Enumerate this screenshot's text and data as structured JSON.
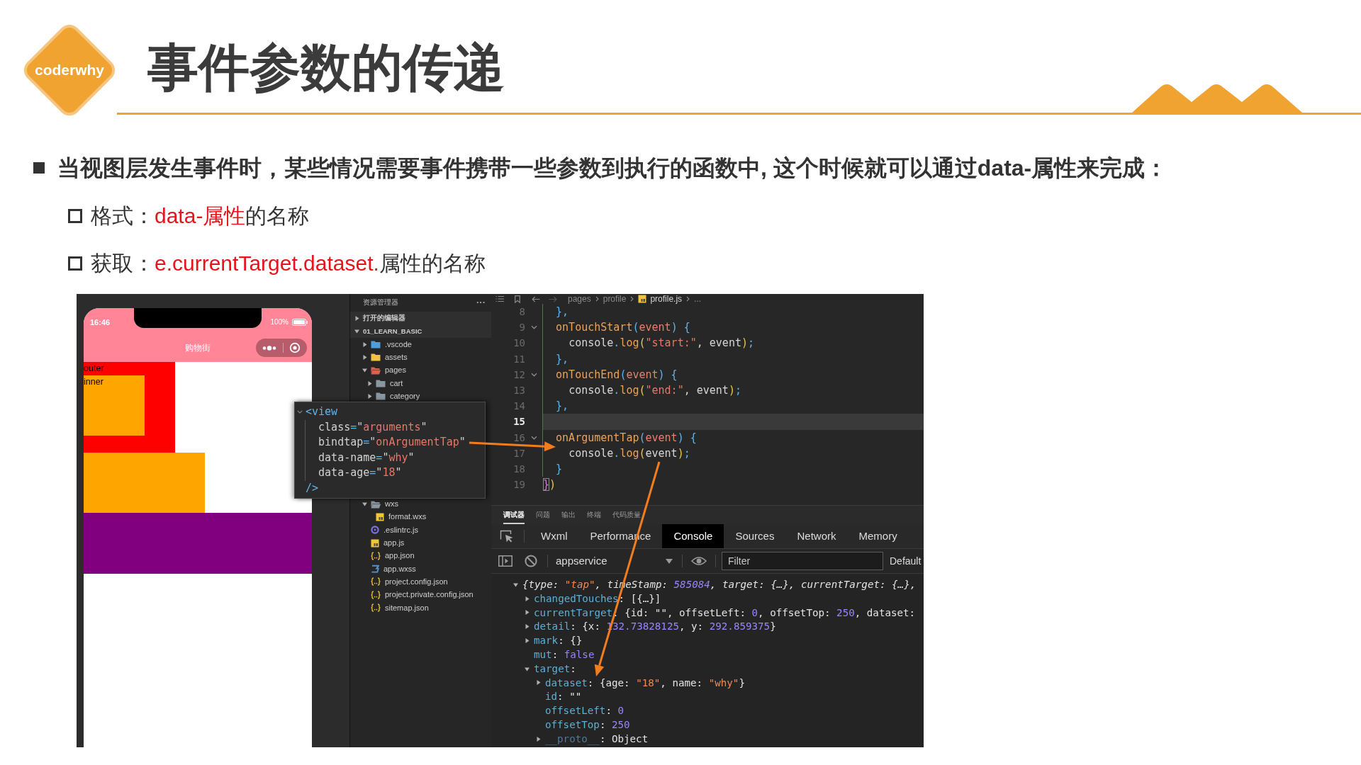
{
  "header": {
    "logo": "coderwhy",
    "title": "事件参数的传递"
  },
  "bullets": [
    {
      "text": "当视图层发生事件时，某些情况需要事件携带一些参数到执行的函数中, 这个时候就可以通过data-属性来完成：",
      "children": [
        {
          "label": "格式：",
          "highlight": "data-属性",
          "rest": "的名称"
        },
        {
          "label": "获取：",
          "highlight": "e.currentTarget.dataset.",
          "rest": "属性的名称"
        }
      ]
    }
  ],
  "screenshot": {
    "simulator": {
      "time": "16:46",
      "battery": "100%",
      "title": "购物街",
      "views": [
        {
          "label": "outer",
          "color": "#ff0000",
          "children": [
            {
              "label": "inner",
              "color": "#ffa500"
            }
          ]
        },
        {
          "color": "#ffa500"
        },
        {
          "color": "#800080"
        }
      ]
    },
    "explorer": {
      "title": "资源管理器",
      "more": "···",
      "sections": [
        {
          "label": "打开的编辑器",
          "expanded": false
        },
        {
          "label": "01_LEARN_BASIC",
          "expanded": true,
          "children": [
            {
              "name": ".vscode",
              "kind": "folder",
              "color": "#4a9fe3",
              "expanded": false
            },
            {
              "name": "assets",
              "kind": "folder",
              "color": "#f2c342",
              "expanded": false
            },
            {
              "name": "pages",
              "kind": "folder",
              "color": "#e0604e",
              "expanded": true,
              "children": [
                {
                  "name": "cart",
                  "kind": "folder",
                  "color": "#8a96a0",
                  "expanded": false
                },
                {
                  "name": "category",
                  "kind": "folder",
                  "color": "#8a96a0",
                  "expanded": false
                }
              ]
            },
            {
              "name": "wxs",
              "kind": "folder",
              "color": "#8a96a0",
              "expanded": true,
              "children": [
                {
                  "name": "format.wxs",
                  "kind": "js"
                }
              ]
            },
            {
              "name": ".eslintrc.js",
              "kind": "lint"
            },
            {
              "name": "app.js",
              "kind": "js"
            },
            {
              "name": "app.json",
              "kind": "json"
            },
            {
              "name": "app.wxss",
              "kind": "style"
            },
            {
              "name": "project.config.json",
              "kind": "json"
            },
            {
              "name": "project.private.config.json",
              "kind": "json"
            },
            {
              "name": "sitemap.json",
              "kind": "json"
            }
          ]
        }
      ]
    },
    "editor": {
      "breadcrumb": [
        {
          "kind": "folder",
          "text": "pages"
        },
        {
          "kind": "folder",
          "text": "profile"
        },
        {
          "kind": "file",
          "text": "profile.js"
        },
        {
          "kind": "more",
          "text": "..."
        }
      ],
      "lines": [
        {
          "number": "8",
          "foldable": false,
          "active": false,
          "tokens": [
            {
              "kind": "punct",
              "text": "  },"
            }
          ]
        },
        {
          "number": "9",
          "foldable": true,
          "active": false,
          "tokens": [
            {
              "kind": "name",
              "text": "  onTouchStart"
            },
            {
              "kind": "punct",
              "text": "("
            },
            {
              "kind": "param",
              "text": "event"
            },
            {
              "kind": "punct",
              "text": ")"
            },
            {
              "kind": "punct",
              "text": " {"
            }
          ]
        },
        {
          "number": "10",
          "foldable": false,
          "active": false,
          "tokens": [
            {
              "kind": "plain",
              "text": "    console"
            },
            {
              "kind": "punct",
              "text": "."
            },
            {
              "kind": "name",
              "text": "log"
            },
            {
              "kind": "paren",
              "text": "("
            },
            {
              "kind": "string",
              "text": "\"start:\""
            },
            {
              "kind": "plain",
              "text": ", event"
            },
            {
              "kind": "paren",
              "text": ")"
            },
            {
              "kind": "punct",
              "text": ";"
            }
          ]
        },
        {
          "number": "11",
          "foldable": false,
          "active": false,
          "tokens": [
            {
              "kind": "punct",
              "text": "  },"
            }
          ]
        },
        {
          "number": "12",
          "foldable": true,
          "active": false,
          "tokens": [
            {
              "kind": "name",
              "text": "  onTouchEnd"
            },
            {
              "kind": "punct",
              "text": "("
            },
            {
              "kind": "param",
              "text": "event"
            },
            {
              "kind": "punct",
              "text": ")"
            },
            {
              "kind": "punct",
              "text": " {"
            }
          ]
        },
        {
          "number": "13",
          "foldable": false,
          "active": false,
          "tokens": [
            {
              "kind": "plain",
              "text": "    console"
            },
            {
              "kind": "punct",
              "text": "."
            },
            {
              "kind": "name",
              "text": "log"
            },
            {
              "kind": "paren",
              "text": "("
            },
            {
              "kind": "string",
              "text": "\"end:\""
            },
            {
              "kind": "plain",
              "text": ", event"
            },
            {
              "kind": "paren",
              "text": ")"
            },
            {
              "kind": "punct",
              "text": ";"
            }
          ]
        },
        {
          "number": "14",
          "foldable": false,
          "active": false,
          "tokens": [
            {
              "kind": "punct",
              "text": "  },"
            }
          ]
        },
        {
          "number": "15",
          "foldable": false,
          "active": true
        },
        {
          "number": "16",
          "foldable": true,
          "active": false,
          "tokens": [
            {
              "kind": "name",
              "text": "  onArgumentTap"
            },
            {
              "kind": "punct",
              "text": "("
            },
            {
              "kind": "param",
              "text": "event"
            },
            {
              "kind": "punct",
              "text": ")"
            },
            {
              "kind": "punct",
              "text": " {"
            }
          ]
        },
        {
          "number": "17",
          "foldable": false,
          "active": false,
          "tokens": [
            {
              "kind": "plain",
              "text": "    console"
            },
            {
              "kind": "punct",
              "text": "."
            },
            {
              "kind": "name",
              "text": "log"
            },
            {
              "kind": "paren",
              "text": "("
            },
            {
              "kind": "plain",
              "text": "event"
            },
            {
              "kind": "paren",
              "text": ")"
            },
            {
              "kind": "punct",
              "text": ";"
            }
          ]
        },
        {
          "number": "18",
          "foldable": false,
          "active": false,
          "tokens": [
            {
              "kind": "punct",
              "text": "  }"
            }
          ]
        },
        {
          "number": "19",
          "foldable": false,
          "active": false,
          "tokens": [
            {
              "kind": "bracket",
              "text": "}"
            },
            {
              "kind": "paren",
              "text": ")"
            }
          ]
        }
      ]
    },
    "tooltip": {
      "lines": [
        {
          "foldable": true,
          "tokens": [
            {
              "kind": "tag",
              "text": "<view"
            }
          ]
        },
        {
          "foldable": false,
          "tokens": [
            {
              "kind": "attr",
              "text": "  class"
            },
            {
              "kind": "punct",
              "text": "="
            },
            {
              "kind": "attr",
              "text": "\""
            },
            {
              "kind": "string",
              "text": "arguments"
            },
            {
              "kind": "attr",
              "text": "\""
            }
          ]
        },
        {
          "foldable": false,
          "tokens": [
            {
              "kind": "attr",
              "text": "  bindtap"
            },
            {
              "kind": "punct",
              "text": "="
            },
            {
              "kind": "attr",
              "text": "\""
            },
            {
              "kind": "string",
              "text": "onArgumentTap"
            },
            {
              "kind": "attr",
              "text": "\""
            }
          ]
        },
        {
          "foldable": false,
          "tokens": [
            {
              "kind": "attr",
              "text": "  data-name"
            },
            {
              "kind": "punct",
              "text": "="
            },
            {
              "kind": "attr",
              "text": "\""
            },
            {
              "kind": "string",
              "text": "why"
            },
            {
              "kind": "attr",
              "text": "\""
            }
          ]
        },
        {
          "foldable": false,
          "tokens": [
            {
              "kind": "attr",
              "text": "  data-age"
            },
            {
              "kind": "punct",
              "text": "="
            },
            {
              "kind": "attr",
              "text": "\""
            },
            {
              "kind": "string",
              "text": "18"
            },
            {
              "kind": "attr",
              "text": "\""
            }
          ]
        },
        {
          "foldable": false,
          "tokens": [
            {
              "kind": "tag",
              "text": "/>"
            }
          ]
        }
      ]
    },
    "devtools": {
      "panel_tabs": [
        {
          "label": "调试器",
          "selected": true
        },
        {
          "label": "问题",
          "selected": false
        },
        {
          "label": "输出",
          "selected": false
        },
        {
          "label": "终端",
          "selected": false
        },
        {
          "label": "代码质量",
          "selected": false
        }
      ],
      "tabs": [
        {
          "label": "Wxml",
          "selected": false
        },
        {
          "label": "Performance",
          "selected": false
        },
        {
          "label": "Console",
          "selected": true
        },
        {
          "label": "Sources",
          "selected": false
        },
        {
          "label": "Network",
          "selected": false
        },
        {
          "label": "Memory",
          "selected": false
        }
      ],
      "context": "appservice",
      "filter": {
        "placeholder": "Filter"
      },
      "levels": "Default",
      "console": [
        {
          "kind": "node",
          "expanded": true,
          "tokens": [
            {
              "kind": "plain",
              "text": "{type: "
            },
            {
              "kind": "string",
              "text": "\"tap\""
            },
            {
              "kind": "plain",
              "text": ", timeStamp: "
            },
            {
              "kind": "number",
              "text": "585084"
            },
            {
              "kind": "plain",
              "text": ", target: {…}, currentTarget: {…},"
            }
          ],
          "children": [
            {
              "kind": "node",
              "expanded": false,
              "tokens": [
                {
                  "kind": "key",
                  "text": "changedTouches"
                },
                {
                  "kind": "plain",
                  "text": ": [{…}]"
                }
              ]
            },
            {
              "kind": "node",
              "expanded": false,
              "tokens": [
                {
                  "kind": "key",
                  "text": "currentTarget"
                },
                {
                  "kind": "plain",
                  "text": ": {id: \"\", offsetLeft: "
                },
                {
                  "kind": "number",
                  "text": "0"
                },
                {
                  "kind": "plain",
                  "text": ", offsetTop: "
                },
                {
                  "kind": "number",
                  "text": "250"
                },
                {
                  "kind": "plain",
                  "text": ", dataset:"
                }
              ]
            },
            {
              "kind": "node",
              "expanded": false,
              "tokens": [
                {
                  "kind": "key",
                  "text": "detail"
                },
                {
                  "kind": "plain",
                  "text": ": {x: "
                },
                {
                  "kind": "number",
                  "text": "132.73828125"
                },
                {
                  "kind": "plain",
                  "text": ", y: "
                },
                {
                  "kind": "number",
                  "text": "292.859375"
                },
                {
                  "kind": "plain",
                  "text": "}"
                }
              ]
            },
            {
              "kind": "node",
              "expanded": false,
              "tokens": [
                {
                  "kind": "key",
                  "text": "mark"
                },
                {
                  "kind": "plain",
                  "text": ": {}"
                }
              ]
            },
            {
              "kind": "leaf",
              "tokens": [
                {
                  "kind": "key",
                  "text": "mut"
                },
                {
                  "kind": "plain",
                  "text": ": "
                },
                {
                  "kind": "number",
                  "text": "false"
                }
              ]
            },
            {
              "kind": "node",
              "expanded": true,
              "tokens": [
                {
                  "kind": "key",
                  "text": "target"
                },
                {
                  "kind": "plain",
                  "text": ":"
                }
              ],
              "children": [
                {
                  "kind": "node",
                  "expanded": false,
                  "tokens": [
                    {
                      "kind": "key",
                      "text": "dataset"
                    },
                    {
                      "kind": "plain",
                      "text": ": {age: "
                    },
                    {
                      "kind": "string",
                      "text": "\"18\""
                    },
                    {
                      "kind": "plain",
                      "text": ", name: "
                    },
                    {
                      "kind": "string",
                      "text": "\"why\""
                    },
                    {
                      "kind": "plain",
                      "text": "}"
                    }
                  ]
                },
                {
                  "kind": "leaf",
                  "tokens": [
                    {
                      "kind": "key",
                      "text": "id"
                    },
                    {
                      "kind": "plain",
                      "text": ": \"\""
                    }
                  ]
                },
                {
                  "kind": "leaf",
                  "tokens": [
                    {
                      "kind": "key",
                      "text": "offsetLeft"
                    },
                    {
                      "kind": "plain",
                      "text": ": "
                    },
                    {
                      "kind": "number",
                      "text": "0"
                    }
                  ]
                },
                {
                  "kind": "leaf",
                  "tokens": [
                    {
                      "kind": "key",
                      "text": "offsetTop"
                    },
                    {
                      "kind": "plain",
                      "text": ": "
                    },
                    {
                      "kind": "number",
                      "text": "250"
                    }
                  ]
                },
                {
                  "kind": "node",
                  "expanded": false,
                  "tokens": [
                    {
                      "kind": "dim",
                      "text": "__proto__"
                    },
                    {
                      "kind": "plain",
                      "text": ": Object"
                    }
                  ]
                }
              ]
            }
          ]
        }
      ]
    }
  }
}
